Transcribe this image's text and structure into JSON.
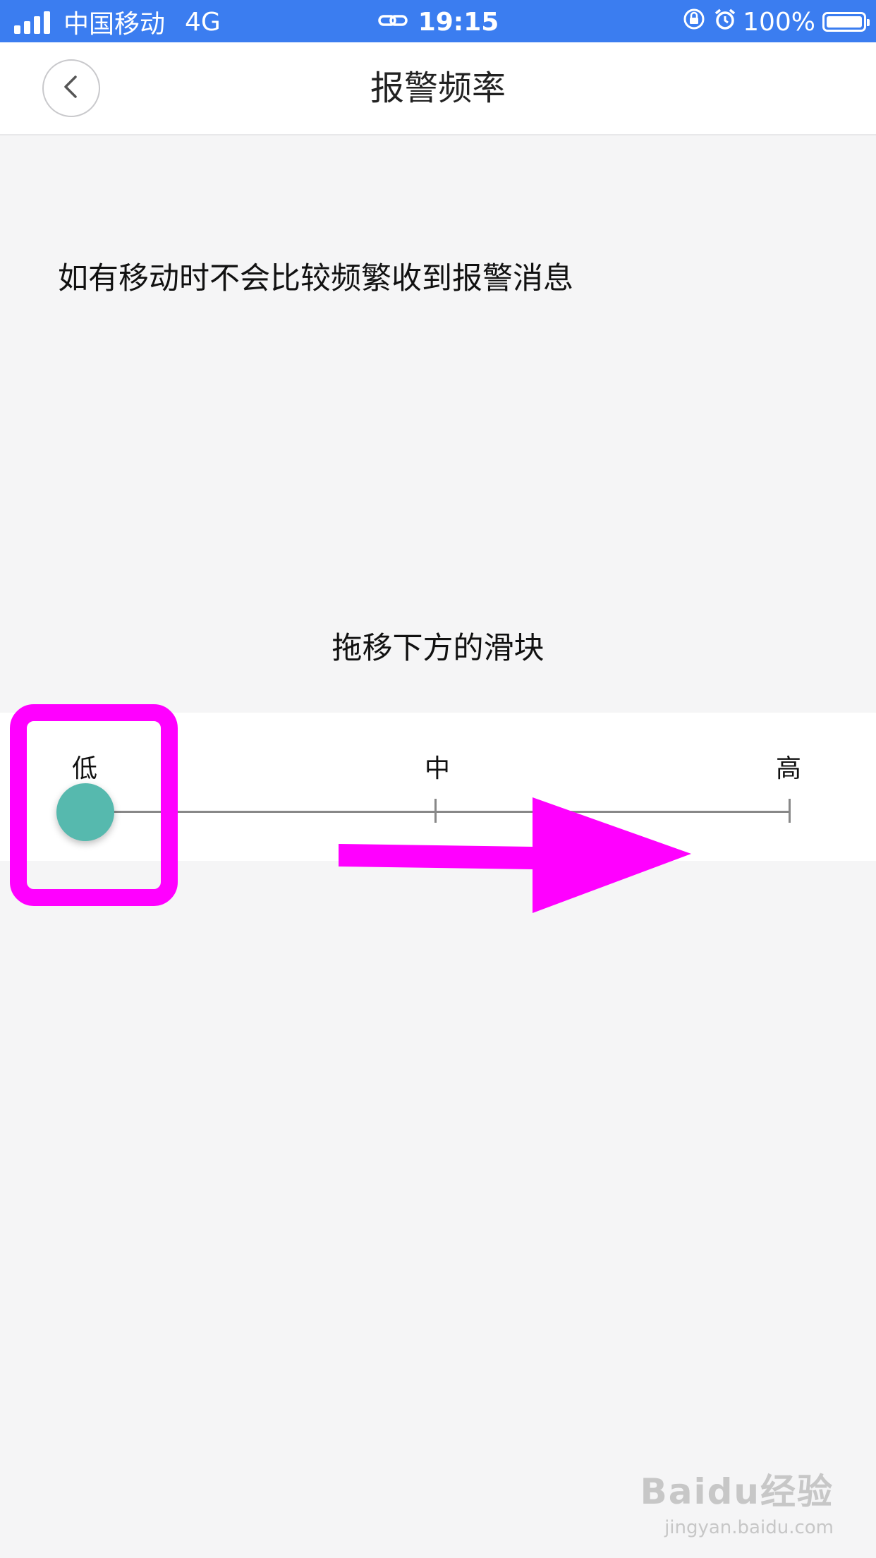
{
  "status_bar": {
    "carrier": "中国移动",
    "network": "4G",
    "time": "19:15",
    "battery": "100%"
  },
  "nav": {
    "title": "报警频率",
    "back_icon": "chevron-left-icon"
  },
  "description": "如有移动时不会比较频繁收到报警消息",
  "instruction": "拖移下方的滑块",
  "slider": {
    "levels": [
      "低",
      "中",
      "高"
    ],
    "selected": "低",
    "thumb_color": "#56b9ae"
  },
  "annotations": {
    "color": "#ff00ff"
  },
  "watermark": {
    "logo": "Baidu经验",
    "url": "jingyan.baidu.com"
  }
}
